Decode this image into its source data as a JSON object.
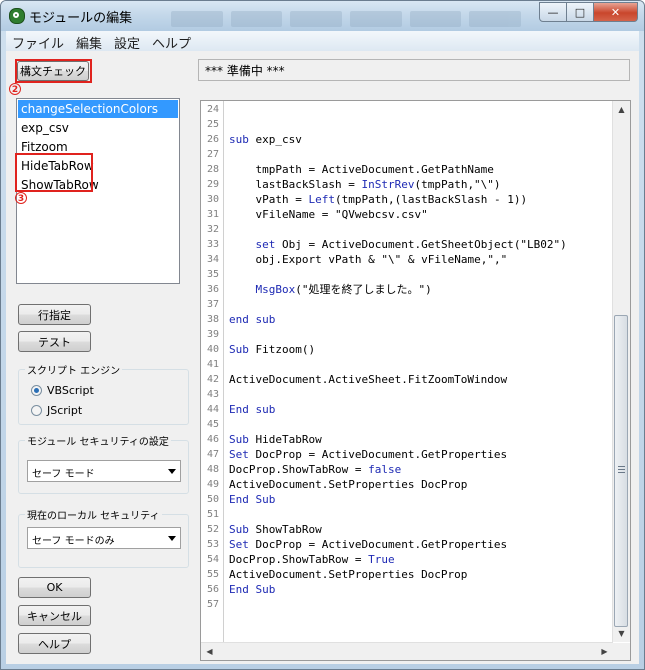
{
  "window": {
    "title": "モジュールの編集",
    "caption": {
      "minimize": "—",
      "maximize": "□",
      "close": "✕"
    }
  },
  "menu": [
    "ファイル",
    "編集",
    "設定",
    "ヘルプ"
  ],
  "toolbar": {
    "syntax_check": "構文チェック",
    "status": "*** 準備中 ***"
  },
  "annotations": {
    "mark2": "2",
    "mark3": "3"
  },
  "functions": [
    "changeSelectionColors",
    "exp_csv",
    "Fitzoom",
    "HideTabRow",
    "ShowTabRow"
  ],
  "buttons": {
    "goto_line": "行指定",
    "test": "テスト",
    "ok": "OK",
    "cancel": "キャンセル",
    "help": "ヘルプ"
  },
  "script_engine": {
    "label": "スクリプト エンジン",
    "options": [
      "VBScript",
      "JScript"
    ],
    "selected": "VBScript"
  },
  "module_security": {
    "label": "モジュール セキュリティの設定",
    "value": "セーフ モード"
  },
  "local_security": {
    "label": "現在のローカル セキュリティ",
    "value": "セーフ モードのみ"
  },
  "code": [
    {
      "n": "24",
      "t": ""
    },
    {
      "n": "25",
      "t": ""
    },
    {
      "n": "26",
      "t": "sub exp_csv"
    },
    {
      "n": "27",
      "t": ""
    },
    {
      "n": "28",
      "t": "    tmpPath = ActiveDocument.GetPathName"
    },
    {
      "n": "29",
      "t": "    lastBackSlash = InStrRev(tmpPath,\"\\\")"
    },
    {
      "n": "30",
      "t": "    vPath = Left(tmpPath,(lastBackSlash - 1))"
    },
    {
      "n": "31",
      "t": "    vFileName = \"QVwebcsv.csv\""
    },
    {
      "n": "32",
      "t": ""
    },
    {
      "n": "33",
      "t": "    set Obj = ActiveDocument.GetSheetObject(\"LB02\")"
    },
    {
      "n": "34",
      "t": "    obj.Export vPath & \"\\\" & vFileName,\",\""
    },
    {
      "n": "35",
      "t": ""
    },
    {
      "n": "36",
      "t": "    MsgBox(\"処理を終了しました。\")"
    },
    {
      "n": "37",
      "t": ""
    },
    {
      "n": "38",
      "t": "end sub"
    },
    {
      "n": "39",
      "t": ""
    },
    {
      "n": "40",
      "t": "Sub Fitzoom()"
    },
    {
      "n": "41",
      "t": ""
    },
    {
      "n": "42",
      "t": "ActiveDocument.ActiveSheet.FitZoomToWindow"
    },
    {
      "n": "43",
      "t": ""
    },
    {
      "n": "44",
      "t": "End sub"
    },
    {
      "n": "45",
      "t": ""
    },
    {
      "n": "46",
      "t": "Sub HideTabRow"
    },
    {
      "n": "47",
      "t": "Set DocProp = ActiveDocument.GetProperties"
    },
    {
      "n": "48",
      "t": "DocProp.ShowTabRow = false"
    },
    {
      "n": "49",
      "t": "ActiveDocument.SetProperties DocProp"
    },
    {
      "n": "50",
      "t": "End Sub"
    },
    {
      "n": "51",
      "t": ""
    },
    {
      "n": "52",
      "t": "Sub ShowTabRow"
    },
    {
      "n": "53",
      "t": "Set DocProp = ActiveDocument.GetProperties"
    },
    {
      "n": "54",
      "t": "DocProp.ShowTabRow = True"
    },
    {
      "n": "55",
      "t": "ActiveDocument.SetProperties DocProp"
    },
    {
      "n": "56",
      "t": "End Sub"
    },
    {
      "n": "57",
      "t": ""
    }
  ],
  "keywords": [
    "sub",
    "Sub",
    "end",
    "End",
    "Set",
    "set",
    "InStrRev",
    "Left",
    "MsgBox",
    "false",
    "True"
  ],
  "colors": {
    "keyword": "#1e2ab4",
    "selection": "#3399ff",
    "highlight": "#e0231e"
  }
}
